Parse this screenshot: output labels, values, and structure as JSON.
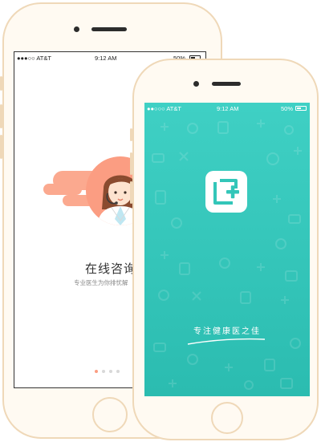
{
  "back_phone": {
    "status_bar": {
      "carrier": "●●●○○ AT&T",
      "time": "9:12 AM",
      "battery": "50%"
    },
    "onboarding": {
      "title": "在线咨询",
      "subtitle": "专业医生为你排忧解",
      "page_indicator": {
        "total": 4,
        "active": 1
      }
    }
  },
  "front_phone": {
    "status_bar": {
      "carrier": "●●○○○ AT&T",
      "time": "9:12 AM",
      "battery": "50%"
    },
    "splash": {
      "slogan": "专注健康医之佳"
    }
  },
  "colors": {
    "teal": "#33c6b9",
    "coral": "#fb9d82",
    "frame": "#efd8b8"
  }
}
